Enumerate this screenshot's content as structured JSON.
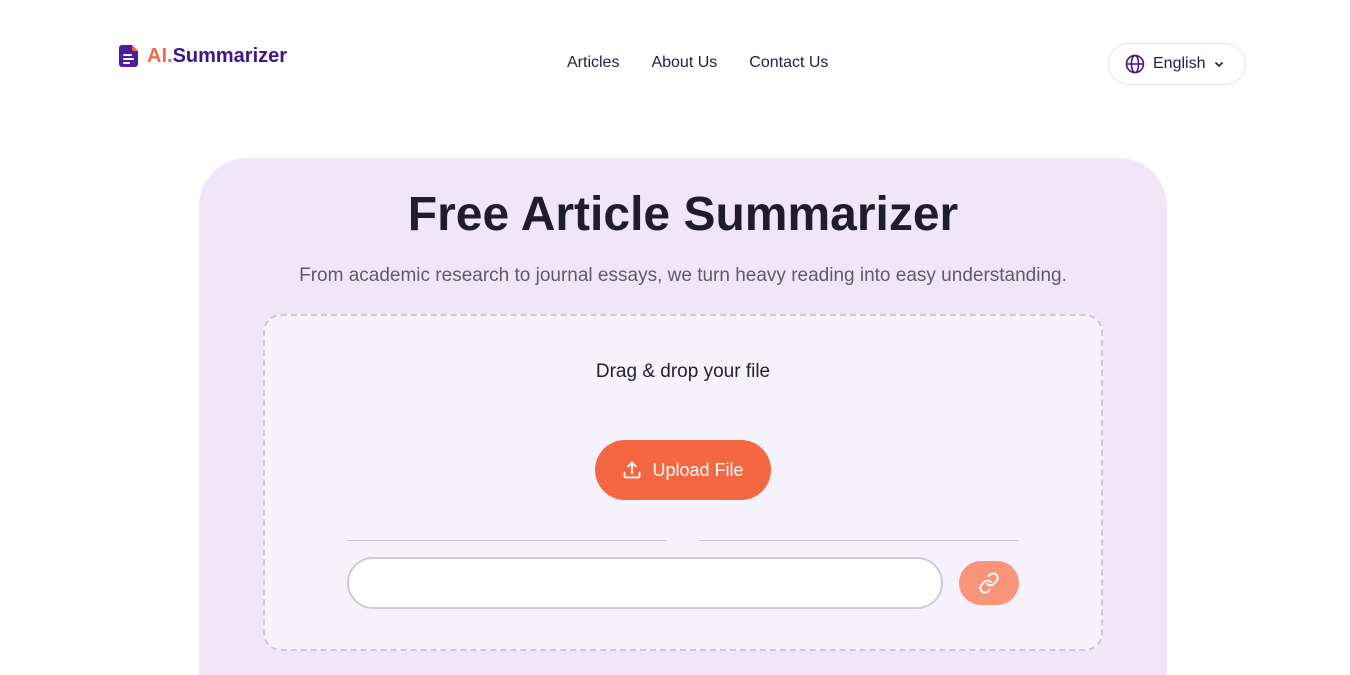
{
  "header": {
    "logo": {
      "prefix": "AI.",
      "name": "Summarizer"
    },
    "nav": [
      {
        "label": "Articles"
      },
      {
        "label": "About Us"
      },
      {
        "label": "Contact Us"
      }
    ],
    "language": {
      "selected": "English",
      "icon": "globe-icon"
    }
  },
  "hero": {
    "title": "Free Article Summarizer",
    "subtitle": "From academic research to journal essays, we turn heavy reading into easy understanding.",
    "dropzone": {
      "prompt": "Drag & drop your file",
      "upload_label": "Upload File",
      "upload_icon": "upload-icon",
      "url_input": {
        "value": "",
        "placeholder": ""
      },
      "link_button_icon": "link-icon"
    }
  },
  "colors": {
    "accent": "#f56743",
    "brand": "#3d1788",
    "hero_bg": "#efe7f8",
    "link_button": "#f8947a"
  }
}
